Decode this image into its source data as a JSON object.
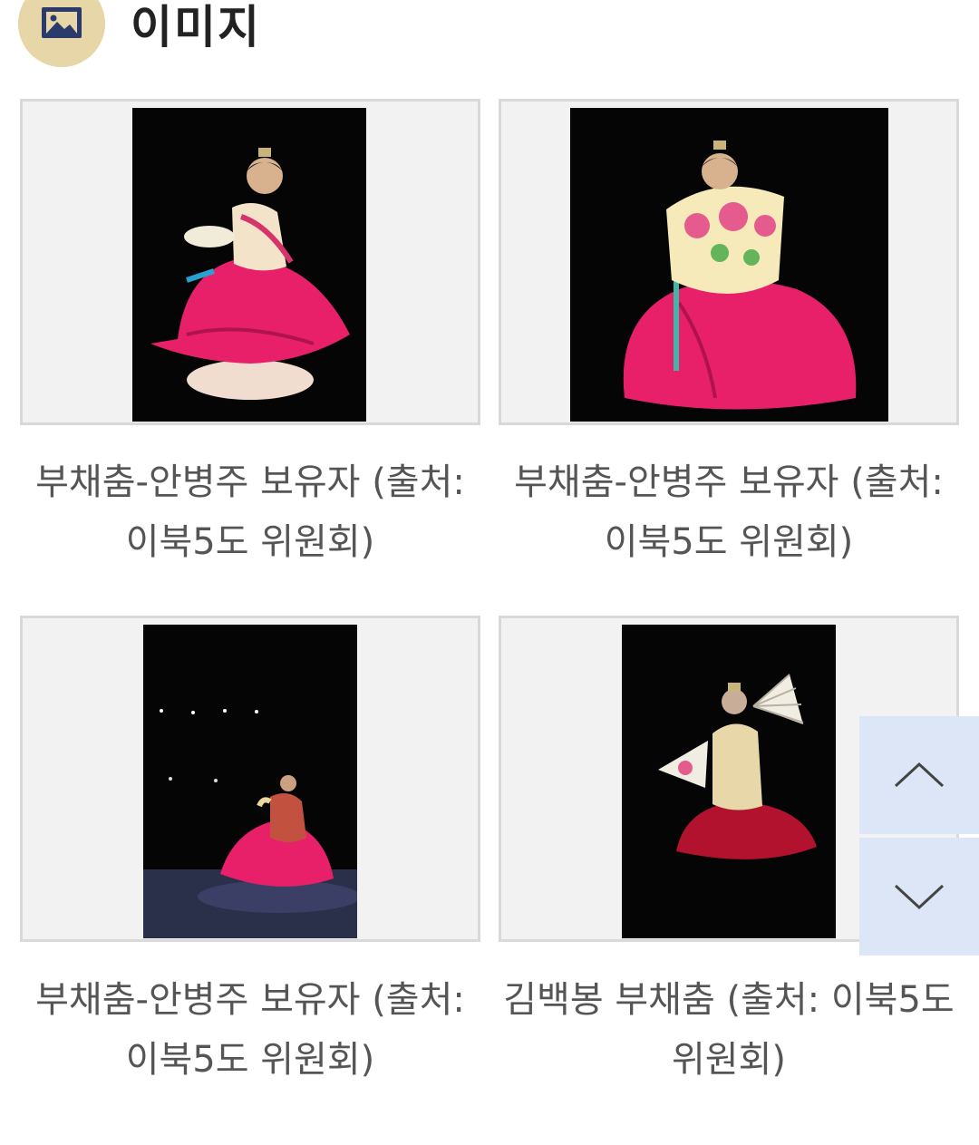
{
  "section": {
    "title": "이미지",
    "icon": "image-icon"
  },
  "gallery": [
    {
      "caption": "부채춤-안병주 보유자 (출처: 이북5도 위원회)"
    },
    {
      "caption": "부채춤-안병주 보유자 (출처: 이북5도 위원회)"
    },
    {
      "caption": "부채춤-안병주 보유자 (출처: 이북5도 위원회)"
    },
    {
      "caption": "김백봉 부채춤 (출처: 이북5도 위원회)"
    }
  ],
  "scroll_controls": {
    "up_icon": "chevron-up-icon",
    "down_icon": "chevron-down-icon"
  },
  "colors": {
    "icon_circle": "#e6d6a8",
    "icon_navy": "#2a3a6b",
    "card_border": "#d9d9d9",
    "card_background": "#f2f2f2",
    "scroll_button": "#dde6f7",
    "skirt_pink": "#e8206a"
  }
}
